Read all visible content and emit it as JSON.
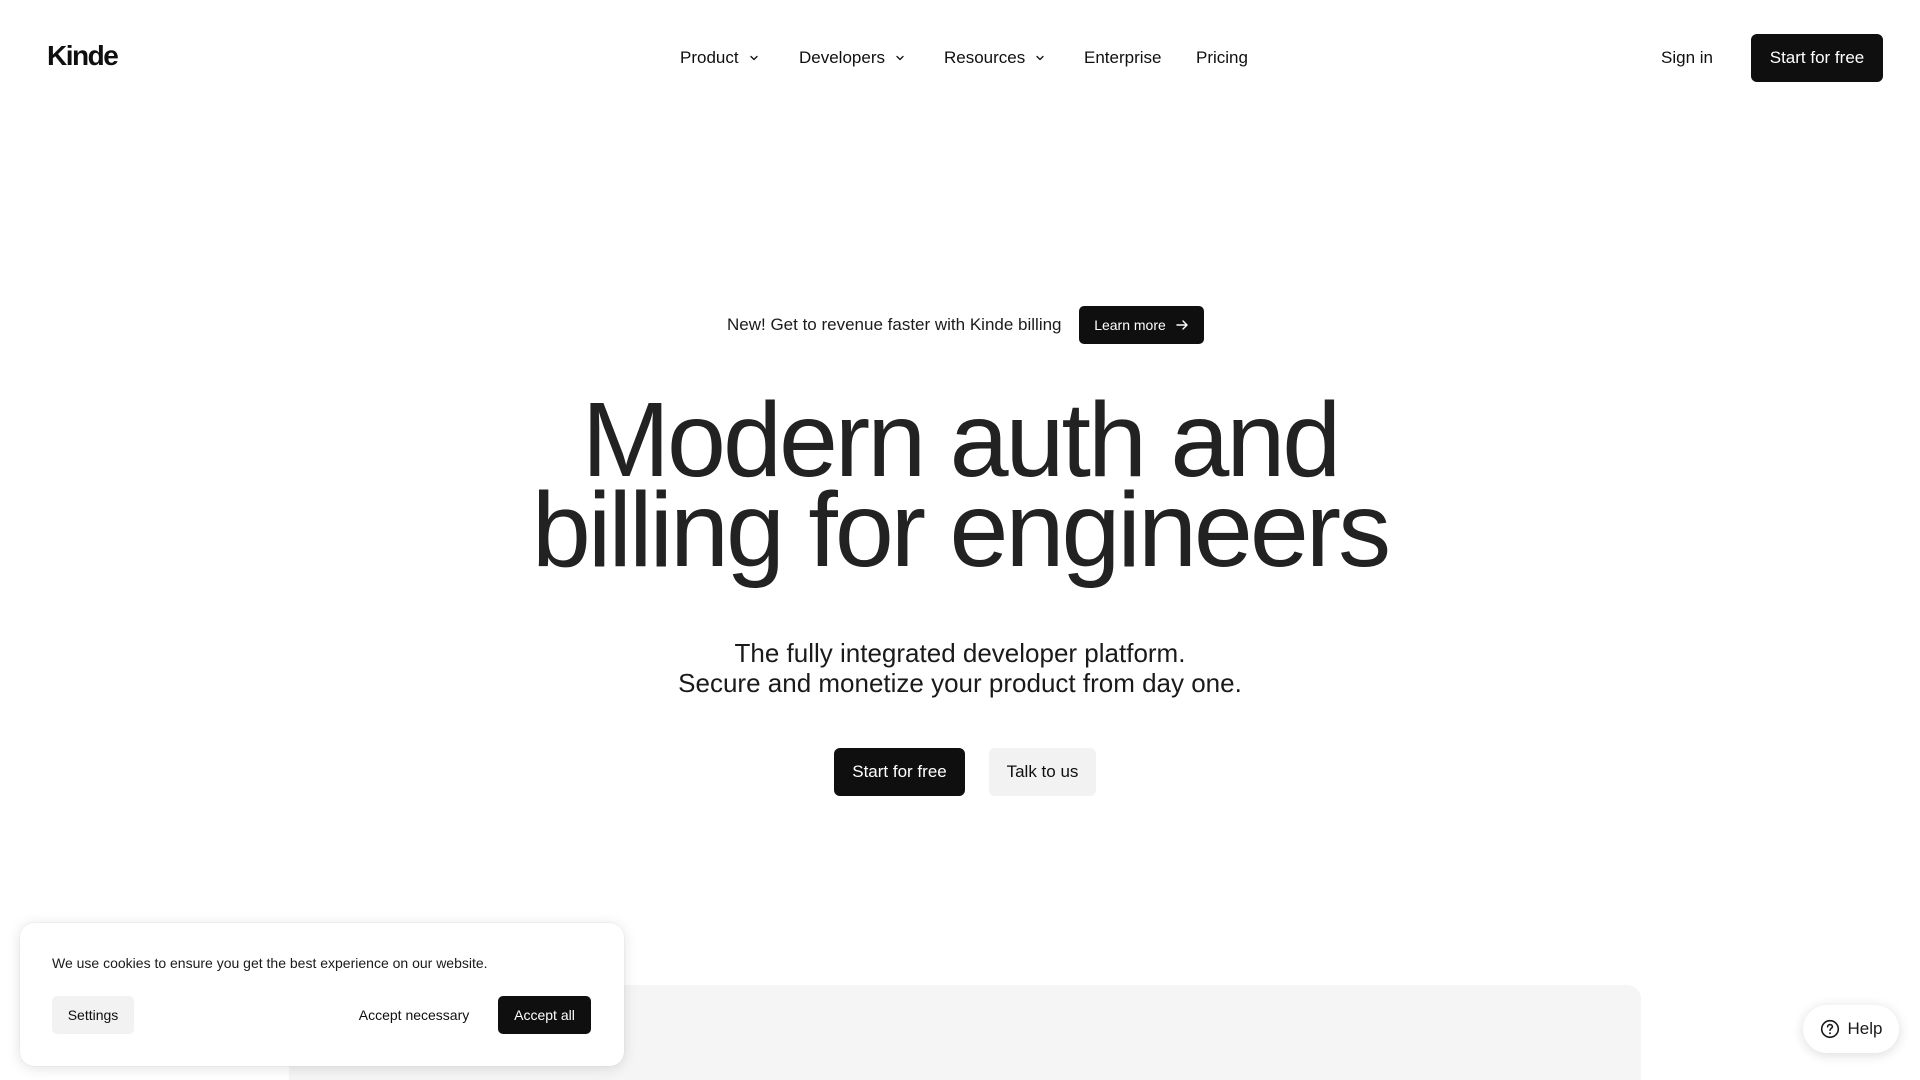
{
  "brand": {
    "logo_text": "Kinde"
  },
  "nav": {
    "items": [
      {
        "label": "Product",
        "has_dropdown": true
      },
      {
        "label": "Developers",
        "has_dropdown": true
      },
      {
        "label": "Resources",
        "has_dropdown": true
      },
      {
        "label": "Enterprise",
        "has_dropdown": false
      },
      {
        "label": "Pricing",
        "has_dropdown": false
      }
    ],
    "sign_in": "Sign in",
    "cta": "Start for free"
  },
  "announcement": {
    "text": "New! Get to revenue faster with Kinde billing",
    "button": "Learn more"
  },
  "hero": {
    "title_line1": "Modern auth and",
    "title_line2": "billing for engineers",
    "subtitle_line1": "The fully integrated developer platform.",
    "subtitle_line2": "Secure and monetize your product from day one.",
    "primary_cta": "Start for free",
    "secondary_cta": "Talk to us"
  },
  "cookie_banner": {
    "message": "We use cookies to ensure you get the best experience on our website.",
    "settings": "Settings",
    "accept_necessary": "Accept necessary",
    "accept_all": "Accept all"
  },
  "help_widget": {
    "label": "Help",
    "icon": "question-circle-icon"
  },
  "colors": {
    "primary": "#0f0f0f",
    "background": "#ffffff",
    "secondary_button": "#f2f2f2",
    "panel": "#f5f5f5",
    "heading": "#222222"
  }
}
